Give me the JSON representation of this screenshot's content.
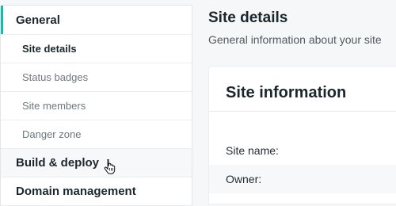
{
  "sidebar": {
    "items": [
      {
        "label": "General"
      },
      {
        "label": "Site details"
      },
      {
        "label": "Status badges"
      },
      {
        "label": "Site members"
      },
      {
        "label": "Danger zone"
      },
      {
        "label": "Build & deploy"
      },
      {
        "label": "Domain management"
      }
    ]
  },
  "main": {
    "title": "Site details",
    "subtitle": "General information about your site",
    "card": {
      "title": "Site information",
      "fields": [
        {
          "label": "Site name:"
        },
        {
          "label": "Owner:"
        }
      ]
    }
  },
  "colors": {
    "accent": "#20b8a7",
    "background": "#f5f7f8"
  }
}
